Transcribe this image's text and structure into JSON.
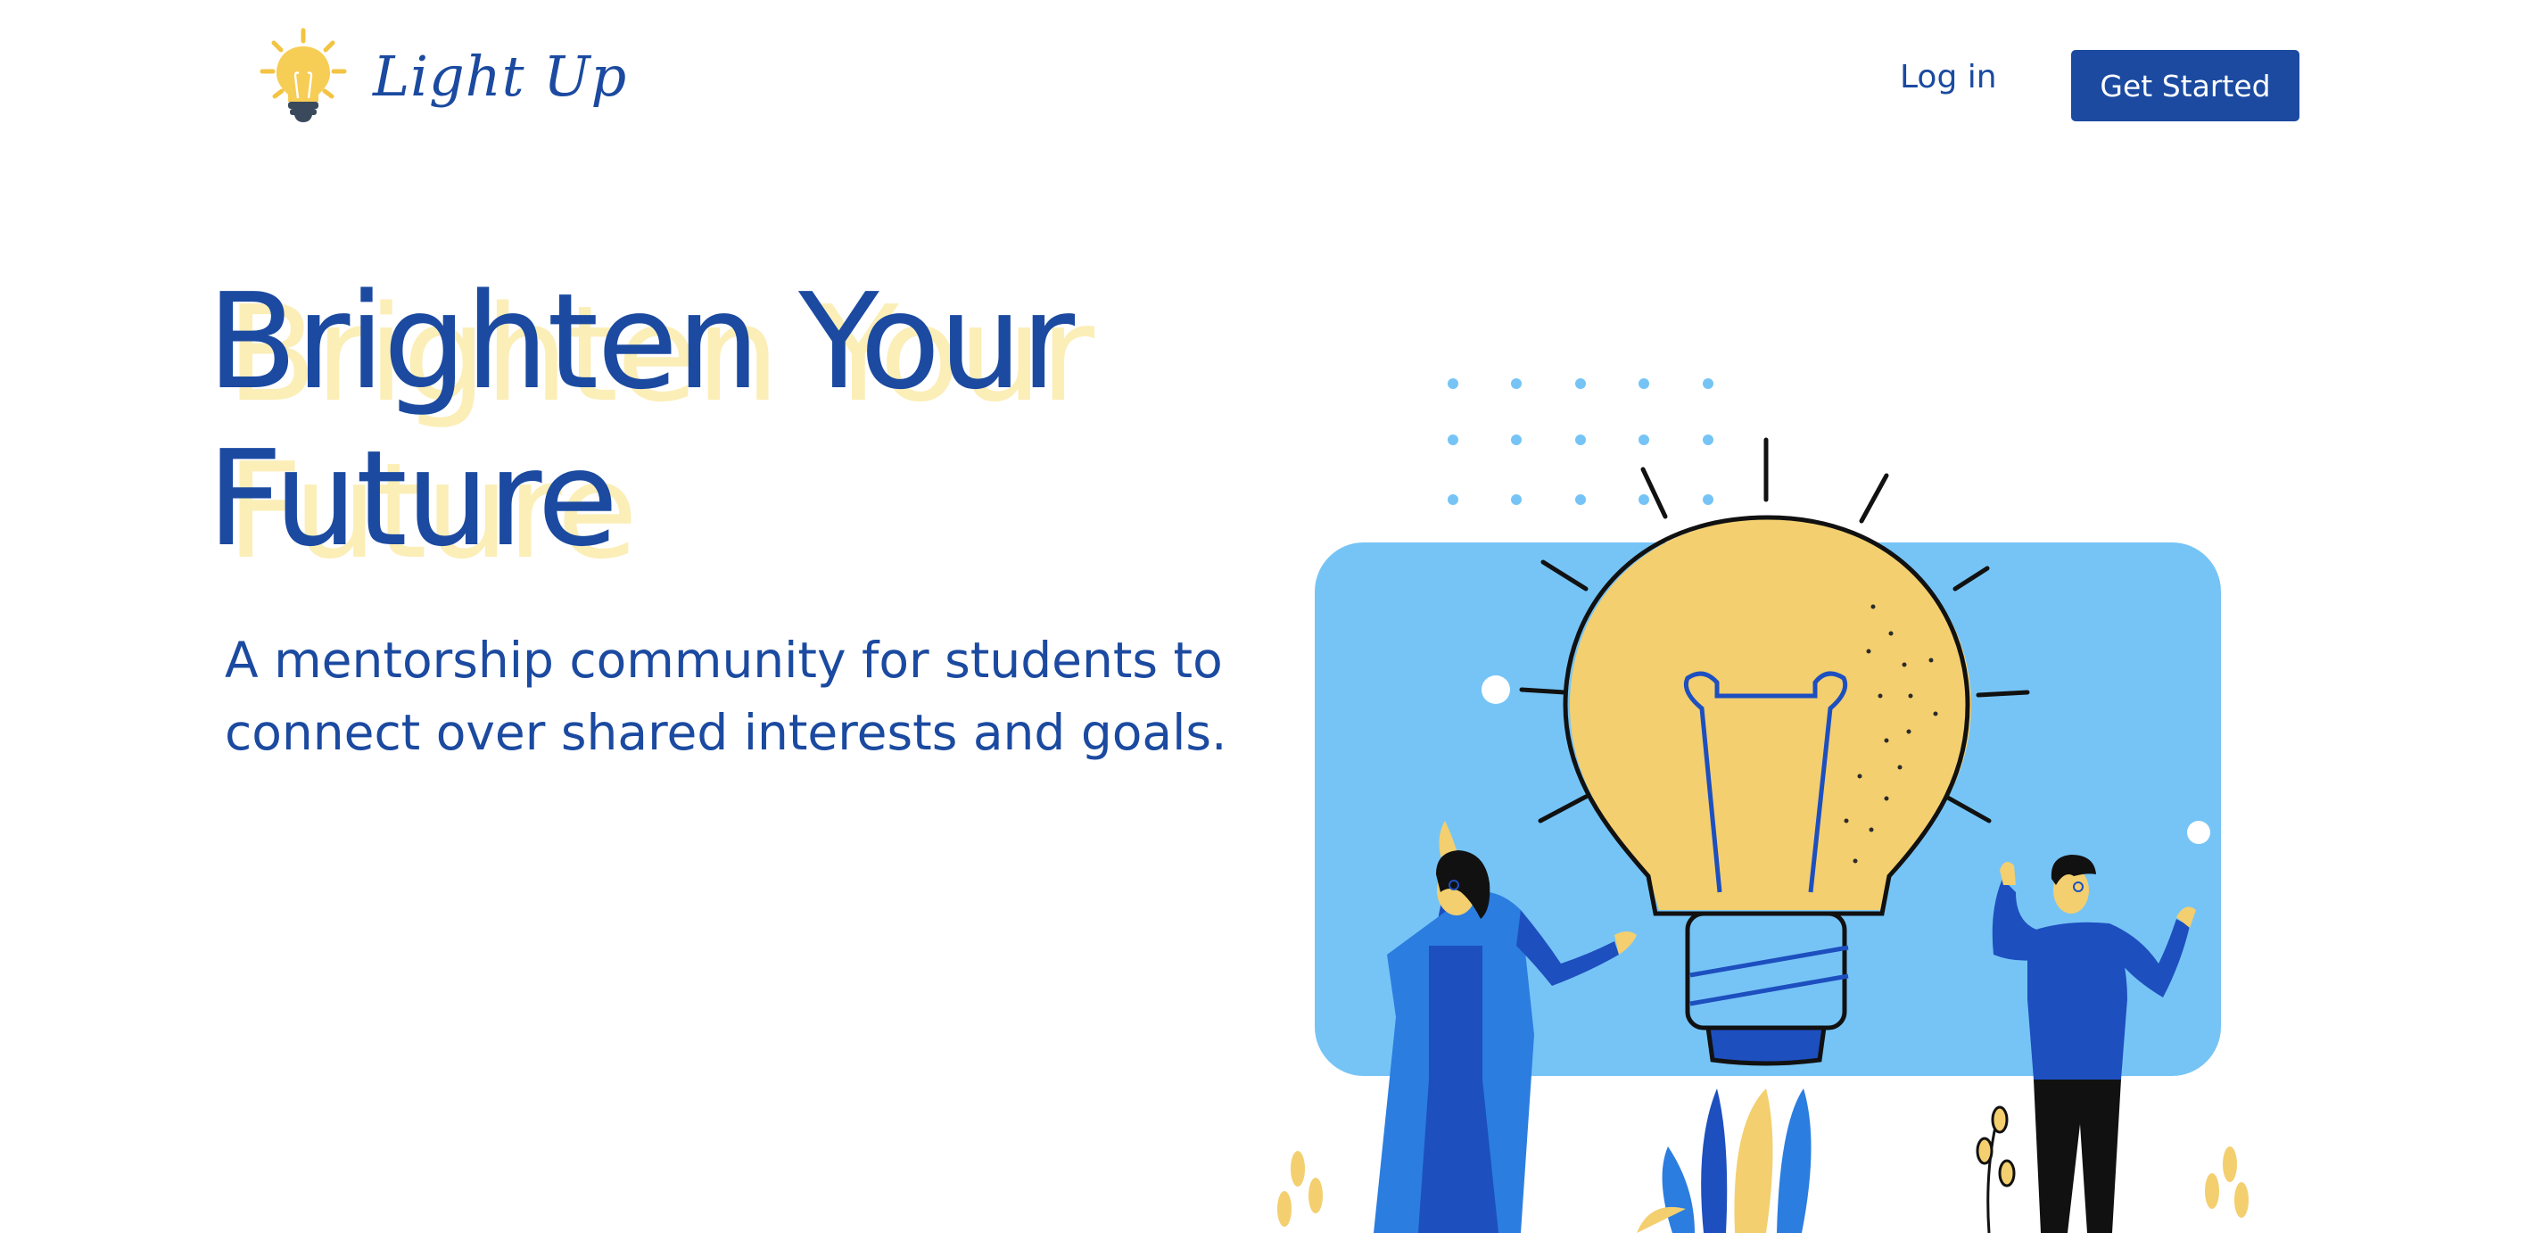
{
  "header": {
    "logo_text": "Light Up",
    "login_label": "Log in",
    "cta_label": "Get Started"
  },
  "hero": {
    "title_line1": "Brighten Your",
    "title_line2": "Future",
    "subtitle_line1": "A mentorship community for students to",
    "subtitle_line2": "connect over shared interests and goals."
  },
  "colors": {
    "brand_blue": "#1b4aa0",
    "title_shadow": "#fbeeb7",
    "bulb_yellow": "#f3cf6f",
    "panel_blue": "#76c4f6"
  },
  "icons": {
    "logo": "lightbulb-icon",
    "illustration": "mentorship-lightbulb-illustration"
  }
}
